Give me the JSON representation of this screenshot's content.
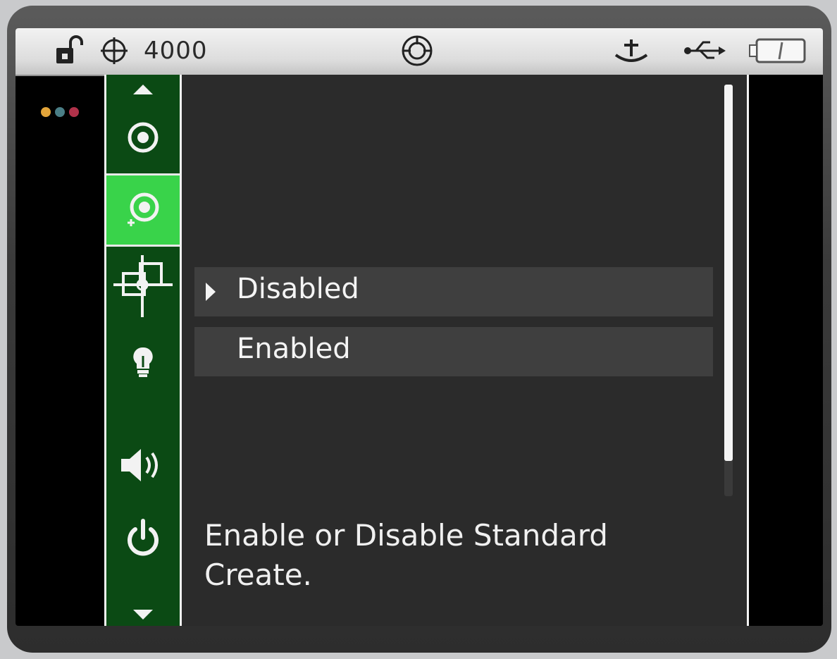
{
  "status_bar": {
    "lock_icon": "unlocked-padlock-icon",
    "crosshair_icon": "crosshair-icon",
    "value": "4000",
    "center_icon": "target-circle-icon",
    "right_icons": [
      "ground-anchor-icon",
      "usb-icon",
      "battery-icon"
    ]
  },
  "indicator_dots": [
    {
      "color": "#e3a53a"
    },
    {
      "color": "#4a7e86"
    },
    {
      "color": "#b0324a"
    }
  ],
  "sidebar": {
    "up_arrow": "arrow-up-icon",
    "down_arrow": "arrow-down-icon",
    "items": [
      {
        "name": "standard-icon",
        "selected": false
      },
      {
        "name": "standard-create-icon",
        "selected": true
      },
      {
        "name": "tolerance-crosshair-icon",
        "selected": false
      },
      {
        "name": "backlight-bulb-icon",
        "selected": false
      },
      {
        "name": "speaker-volume-icon",
        "selected": false
      },
      {
        "name": "power-icon",
        "selected": false
      }
    ],
    "accent": "#0b4a14",
    "selected_accent": "#39d34a"
  },
  "options": [
    {
      "label": "Disabled",
      "selected": true
    },
    {
      "label": "Enabled",
      "selected": false
    }
  ],
  "help_text": {
    "line1": "Enable or Disable Standard",
    "line2": "Create."
  },
  "scrollbar": {
    "position_fraction": 0.0,
    "visible_fraction": 0.91
  }
}
